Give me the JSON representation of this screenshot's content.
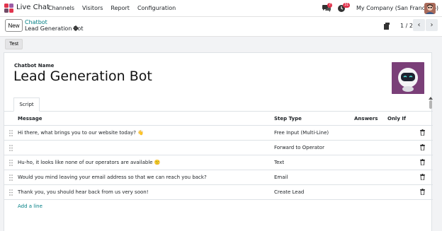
{
  "navbar": {
    "app_name": "Live Chat",
    "menu": [
      "Channels",
      "Visitors",
      "Report",
      "Configuration"
    ],
    "chat_count": "7",
    "activity_count": "31",
    "company": "My Company (San Francisco)"
  },
  "control": {
    "new_label": "New",
    "breadcrumb_parent": "Chatbot",
    "breadcrumb_current": "Lead Generation Bot",
    "pager_value": "1 / 2"
  },
  "statusbar": {
    "test_label": "Test"
  },
  "form": {
    "name_label": "Chatbot Name",
    "name_value": "Lead Generation Bot",
    "tab_label": "Script"
  },
  "table": {
    "headers": {
      "message": "Message",
      "step_type": "Step Type",
      "answers": "Answers",
      "only_if": "Only If"
    },
    "rows": [
      {
        "message": "Hi there, what brings you to our website today? 👋",
        "step_type": "Free Input (Multi-Line)"
      },
      {
        "message": "",
        "step_type": "Forward to Operator"
      },
      {
        "message": "Hu-ho, it looks like none of our operators are available 🙁",
        "step_type": "Text"
      },
      {
        "message": "Would you mind leaving your email address so that we can reach you back?",
        "step_type": "Email"
      },
      {
        "message": "Thank you, you should hear back from us very soon!",
        "step_type": "Create Lead"
      }
    ],
    "add_line": "Add a line"
  },
  "colors": {
    "accent": "#017e84",
    "brand": "#714b67",
    "badge": "#e0344d"
  }
}
